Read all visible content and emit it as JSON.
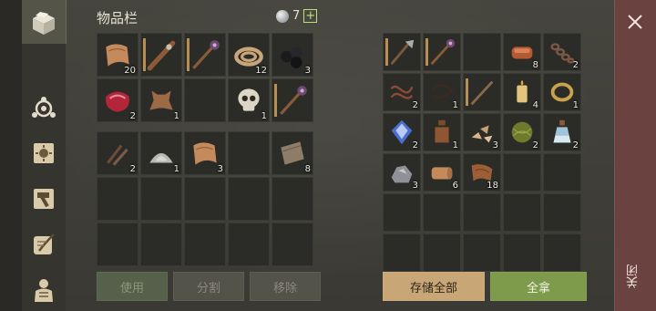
{
  "header": {
    "title": "物品栏",
    "currency_count": "7",
    "currency_icon": "silver-coin-icon",
    "add_label": "+"
  },
  "dock": {
    "items": [
      {
        "name": "chest-icon",
        "active": true
      },
      {
        "name": "crafting-icon"
      },
      {
        "name": "sun-book-icon"
      },
      {
        "name": "hammer-icon"
      },
      {
        "name": "quill-scroll-icon"
      },
      {
        "name": "armor-icon"
      }
    ]
  },
  "inventory": {
    "top": [
      {
        "icon": "leather-scraps",
        "count": "20"
      },
      {
        "icon": "spiked-club",
        "count": "",
        "durability": true
      },
      {
        "icon": "mace",
        "count": "",
        "durability": true
      },
      {
        "icon": "rope-coil",
        "count": "12"
      },
      {
        "icon": "coal",
        "count": "3"
      },
      {
        "icon": "raw-meat",
        "count": "2"
      },
      {
        "icon": "animal-hide",
        "count": "1"
      },
      {
        "icon": "",
        "count": ""
      },
      {
        "icon": "skull",
        "count": "1"
      },
      {
        "icon": "mace",
        "count": "",
        "durability": true
      }
    ],
    "bottom": [
      {
        "icon": "nails",
        "count": "2"
      },
      {
        "icon": "stone-dust",
        "count": "1"
      },
      {
        "icon": "leather-scraps",
        "count": "3"
      },
      {
        "icon": "",
        "count": ""
      },
      {
        "icon": "wood-plank",
        "count": "8"
      },
      {
        "icon": "",
        "count": ""
      },
      {
        "icon": "",
        "count": ""
      },
      {
        "icon": "",
        "count": ""
      },
      {
        "icon": "",
        "count": ""
      },
      {
        "icon": "",
        "count": ""
      },
      {
        "icon": "",
        "count": ""
      },
      {
        "icon": "",
        "count": ""
      },
      {
        "icon": "",
        "count": ""
      },
      {
        "icon": "",
        "count": ""
      },
      {
        "icon": "",
        "count": ""
      }
    ]
  },
  "storage": {
    "slots": [
      {
        "icon": "halberd",
        "count": "",
        "durability": true
      },
      {
        "icon": "mace",
        "count": "",
        "durability": true
      },
      {
        "icon": "",
        "count": ""
      },
      {
        "icon": "copper-ingot",
        "count": "8"
      },
      {
        "icon": "chain",
        "count": "2"
      },
      {
        "icon": "tangled-fibers",
        "count": "2"
      },
      {
        "icon": "leather-cord",
        "count": "1"
      },
      {
        "icon": "staff",
        "count": "",
        "durability": true
      },
      {
        "icon": "candle",
        "count": "4"
      },
      {
        "icon": "gold-ring",
        "count": "1"
      },
      {
        "icon": "blue-crystal",
        "count": "2"
      },
      {
        "icon": "bottle",
        "count": "1"
      },
      {
        "icon": "wood-chips",
        "count": "3"
      },
      {
        "icon": "fiber-ball",
        "count": "2"
      },
      {
        "icon": "potion",
        "count": "2"
      },
      {
        "icon": "iron-ore",
        "count": "3"
      },
      {
        "icon": "cloth-roll",
        "count": "6"
      },
      {
        "icon": "leather-strips",
        "count": "18"
      },
      {
        "icon": "",
        "count": ""
      },
      {
        "icon": "",
        "count": ""
      },
      {
        "icon": "",
        "count": ""
      },
      {
        "icon": "",
        "count": ""
      },
      {
        "icon": "",
        "count": ""
      },
      {
        "icon": "",
        "count": ""
      },
      {
        "icon": "",
        "count": ""
      },
      {
        "icon": "",
        "count": ""
      },
      {
        "icon": "",
        "count": ""
      },
      {
        "icon": "",
        "count": ""
      },
      {
        "icon": "",
        "count": ""
      },
      {
        "icon": "",
        "count": ""
      }
    ]
  },
  "actions": {
    "use_label": "使用",
    "split_label": "分割",
    "remove_label": "移除",
    "store_all_label": "存储全部",
    "take_all_label": "全拿"
  },
  "close": {
    "label": "关闭"
  },
  "colors": {
    "take_all": "#7e9b4c",
    "store_all": "#c8a676",
    "close_panel": "#6a4240",
    "plus": "#b9e07a"
  }
}
